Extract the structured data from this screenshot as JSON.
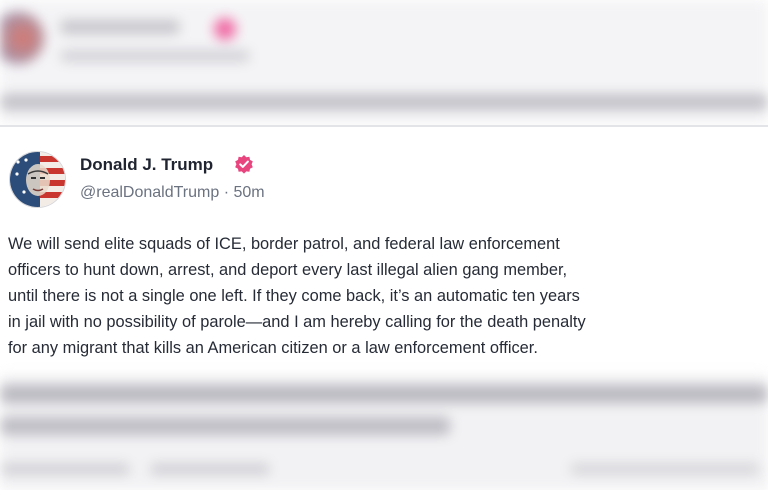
{
  "post": {
    "author_name": "Donald J. Trump",
    "handle": "@realDonaldTrump",
    "separator": " · ",
    "timestamp": "50m",
    "verified_icon": "verified-badge-icon",
    "body_lines": [
      "We will send elite squads of ICE, border patrol, and federal law enforcement",
      "officers to hunt down, arrest, and deport every last illegal alien gang member,",
      "until there is not a single one left. If they come back, it’s an automatic ten years",
      "in jail with no possibility of parole—and I am hereby calling for the death penalty",
      "for any migrant that kills an American citizen or a law enforcement officer."
    ]
  },
  "colors": {
    "verified_badge": "#e8457f",
    "text_primary": "#1f2430",
    "text_secondary": "#6b7280",
    "divider": "#e3e4e8"
  }
}
